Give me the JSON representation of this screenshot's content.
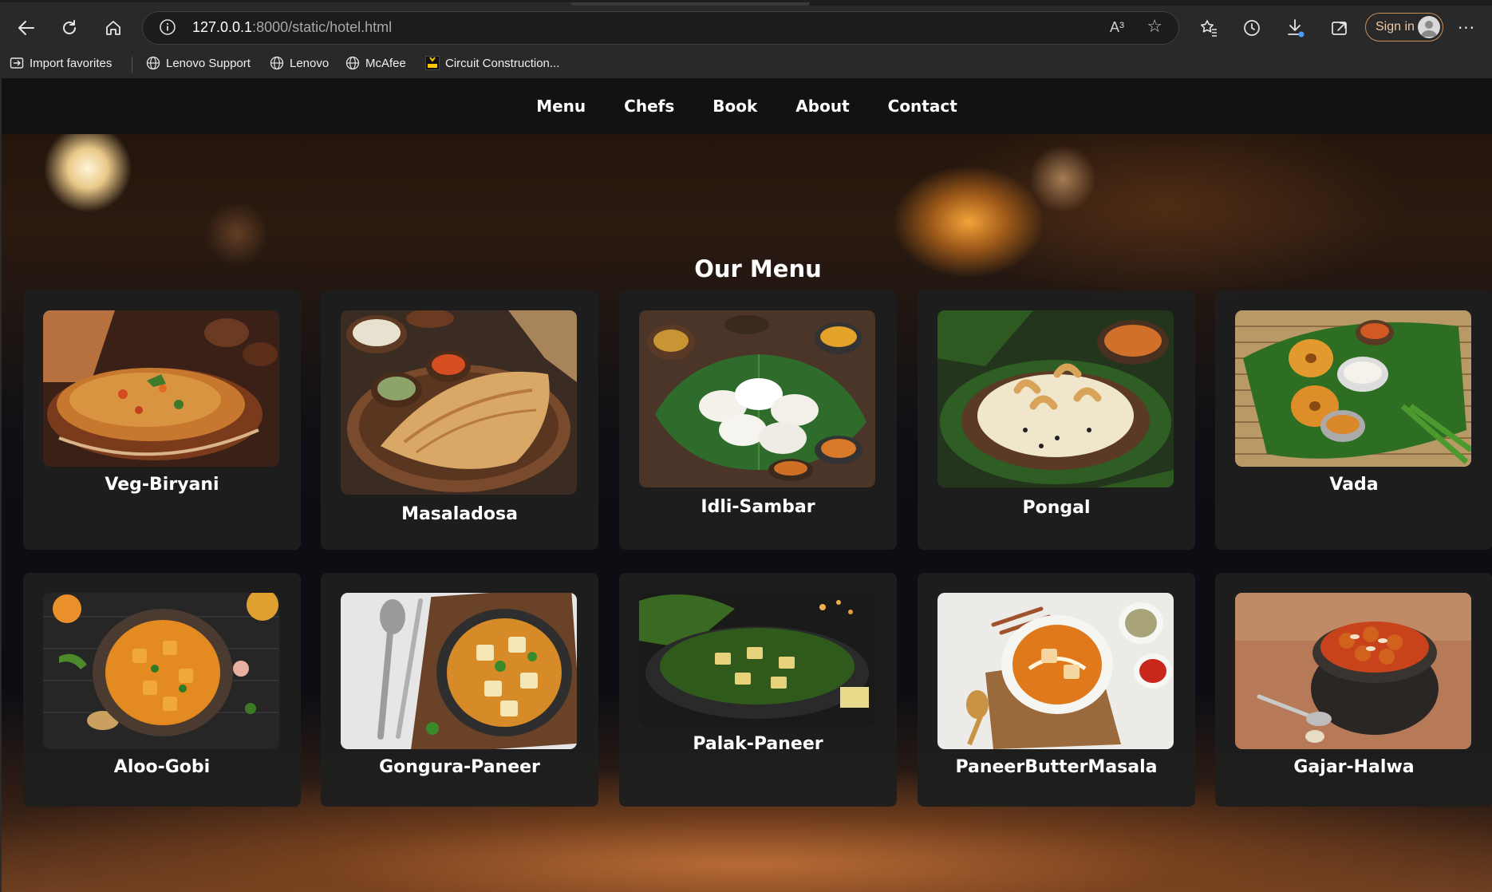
{
  "browser": {
    "url_host": "127.0.0.1",
    "url_path": ":8000/static/hotel.html",
    "read_aloud_label": "A³",
    "signin_label": "Sign in",
    "bookmarks": [
      {
        "label": "Import favorites",
        "icon": "import-icon"
      },
      {
        "label": "Lenovo Support",
        "icon": "globe-icon"
      },
      {
        "label": "Lenovo",
        "icon": "globe-icon"
      },
      {
        "label": "McAfee",
        "icon": "globe-icon"
      },
      {
        "label": "Circuit Construction...",
        "icon": "phet-icon"
      }
    ]
  },
  "nav": {
    "items": [
      "Menu",
      "Chefs",
      "Book",
      "About",
      "Contact"
    ]
  },
  "menu": {
    "title": "Our Menu",
    "items": [
      {
        "name": "Veg-Biryani"
      },
      {
        "name": "Masaladosa"
      },
      {
        "name": "Idli-Sambar"
      },
      {
        "name": "Pongal"
      },
      {
        "name": "Vada"
      },
      {
        "name": "Aloo-Gobi"
      },
      {
        "name": "Gongura-Paneer"
      },
      {
        "name": "Palak-Paneer"
      },
      {
        "name": "PaneerButterMasala"
      },
      {
        "name": "Gajar-Halwa"
      }
    ]
  },
  "colors": {
    "chrome_bg": "#292929",
    "navbar_bg": "#121212",
    "card_bg": "#1e1e1e",
    "signin_border": "#c78c5a",
    "text": "#ffffff"
  }
}
